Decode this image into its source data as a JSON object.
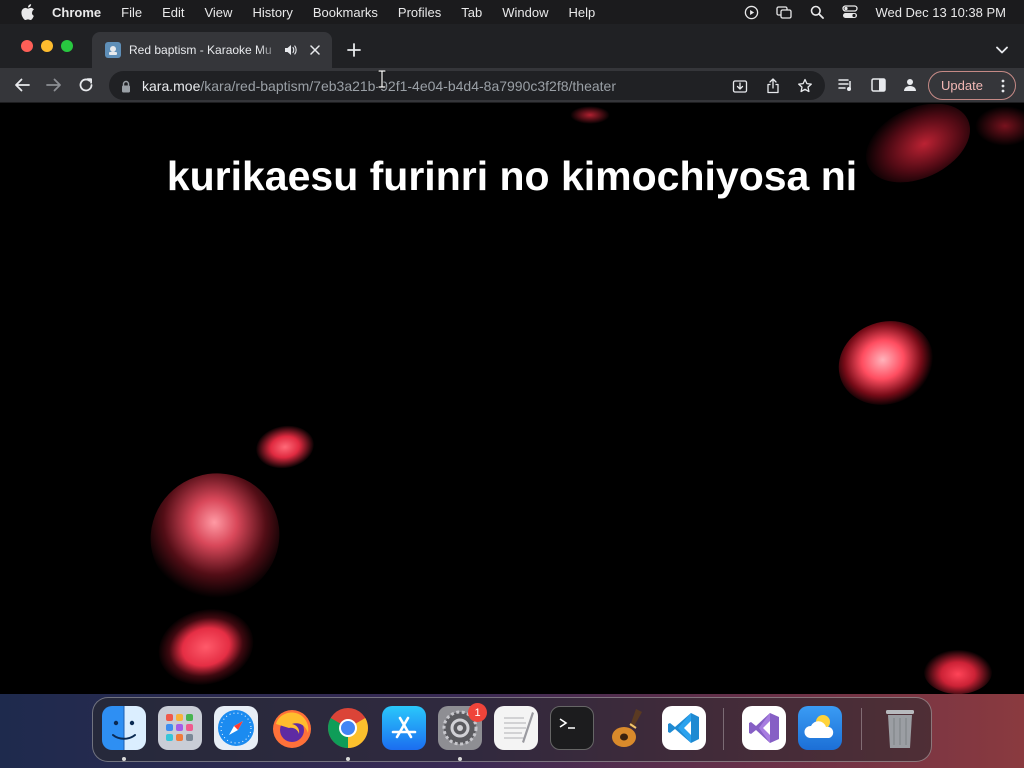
{
  "menubar": {
    "app_name": "Chrome",
    "items": [
      "File",
      "Edit",
      "View",
      "History",
      "Bookmarks",
      "Profiles",
      "Tab",
      "Window",
      "Help"
    ],
    "status_icons": [
      "play-circle-icon",
      "screen-mirror-icon",
      "spotlight-search-icon",
      "control-center-icon"
    ],
    "clock": "Wed Dec 13  10:38 PM"
  },
  "tab": {
    "title": "Red baptism - Karaoke Mu",
    "favicon": "kara-moe-favicon",
    "playing_audio": true
  },
  "toolbar": {
    "url_domain": "kara.moe",
    "url_path": "/kara/red-baptism/7eb3a21b-92f1-4e04-b4d4-8a7990c3f2f8/theater",
    "update_label": "Update"
  },
  "theater": {
    "lyric": "kurikaesu furinri no kimochiyosa ni",
    "background_color": "#000000",
    "petal_color": "#ff3b4e"
  },
  "dock": {
    "apps": [
      "Finder",
      "Launchpad",
      "Safari",
      "Firefox",
      "Google Chrome",
      "App Store",
      "System Settings",
      "TextEdit",
      "Terminal",
      "GarageBand",
      "Visual Studio Code",
      "Visual Studio",
      "Weather",
      "Trash"
    ],
    "system_settings_badge": "1"
  }
}
